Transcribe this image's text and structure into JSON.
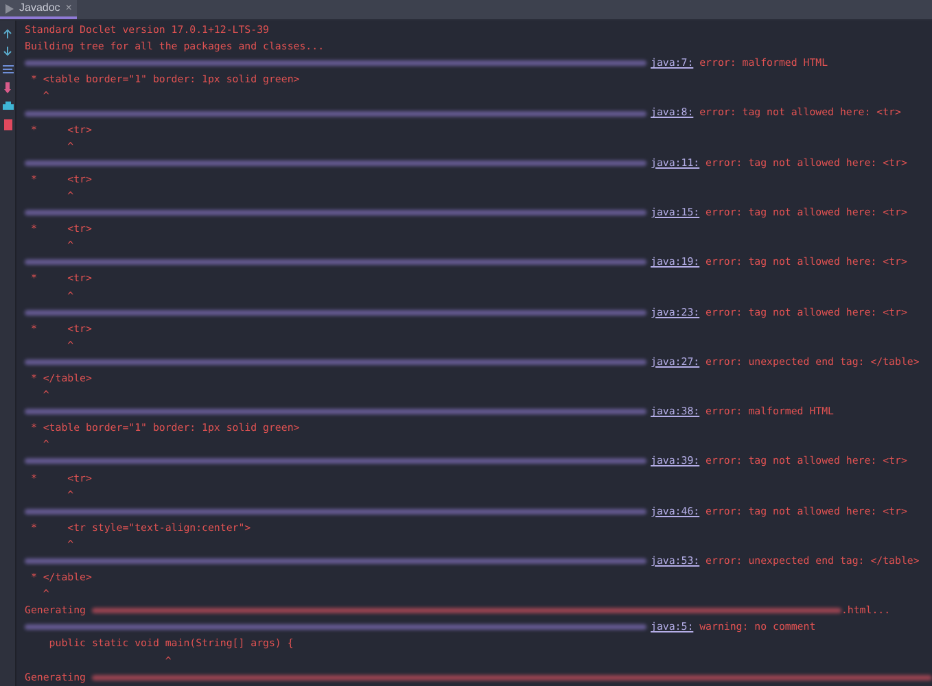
{
  "tab": {
    "label": "Javadoc",
    "close": "×",
    "selected": true
  },
  "lines": [
    {
      "kind": "text",
      "text": "Standard Doclet version 17.0.1+12-LTS-39"
    },
    {
      "kind": "text",
      "text": "Building tree for all the packages and classes..."
    },
    {
      "kind": "error",
      "location": "java:7:",
      "message": "error: malformed HTML"
    },
    {
      "kind": "source",
      "text": " * <table border=\"1\" border: 1px solid green>"
    },
    {
      "kind": "source",
      "text": "   ^"
    },
    {
      "kind": "error",
      "location": "java:8:",
      "message": "error: tag not allowed here: <tr>"
    },
    {
      "kind": "source",
      "text": " *     <tr>"
    },
    {
      "kind": "source",
      "text": "       ^"
    },
    {
      "kind": "error",
      "location": "java:11:",
      "message": "error: tag not allowed here: <tr>"
    },
    {
      "kind": "source",
      "text": " *     <tr>"
    },
    {
      "kind": "source",
      "text": "       ^"
    },
    {
      "kind": "error",
      "location": "java:15:",
      "message": "error: tag not allowed here: <tr>"
    },
    {
      "kind": "source",
      "text": " *     <tr>"
    },
    {
      "kind": "source",
      "text": "       ^"
    },
    {
      "kind": "error",
      "location": "java:19:",
      "message": "error: tag not allowed here: <tr>"
    },
    {
      "kind": "source",
      "text": " *     <tr>"
    },
    {
      "kind": "source",
      "text": "       ^"
    },
    {
      "kind": "error",
      "location": "java:23:",
      "message": "error: tag not allowed here: <tr>"
    },
    {
      "kind": "source",
      "text": " *     <tr>"
    },
    {
      "kind": "source",
      "text": "       ^"
    },
    {
      "kind": "error",
      "location": "java:27:",
      "message": "error: unexpected end tag: </table>"
    },
    {
      "kind": "source",
      "text": " * </table>"
    },
    {
      "kind": "source",
      "text": "   ^"
    },
    {
      "kind": "error",
      "location": "java:38:",
      "message": "error: malformed HTML"
    },
    {
      "kind": "source",
      "text": " * <table border=\"1\" border: 1px solid green>"
    },
    {
      "kind": "source",
      "text": "   ^"
    },
    {
      "kind": "error",
      "location": "java:39:",
      "message": "error: tag not allowed here: <tr>"
    },
    {
      "kind": "source",
      "text": " *     <tr>"
    },
    {
      "kind": "source",
      "text": "       ^"
    },
    {
      "kind": "error",
      "location": "java:46:",
      "message": "error: tag not allowed here: <tr>"
    },
    {
      "kind": "source",
      "text": " *     <tr style=\"text-align:center\">"
    },
    {
      "kind": "source",
      "text": "       ^"
    },
    {
      "kind": "error",
      "location": "java:53:",
      "message": "error: unexpected end tag: </table>"
    },
    {
      "kind": "source",
      "text": " * </table>"
    },
    {
      "kind": "source",
      "text": "   ^"
    },
    {
      "kind": "generating",
      "prefix": "Generating",
      "suffix": ".html..."
    },
    {
      "kind": "error",
      "location": "java:5:",
      "message": "warning: no comment"
    },
    {
      "kind": "source",
      "text": "    public static void main(String[] args) {"
    },
    {
      "kind": "source",
      "text": "                       ^"
    },
    {
      "kind": "generating",
      "prefix": "Generating"
    }
  ]
}
